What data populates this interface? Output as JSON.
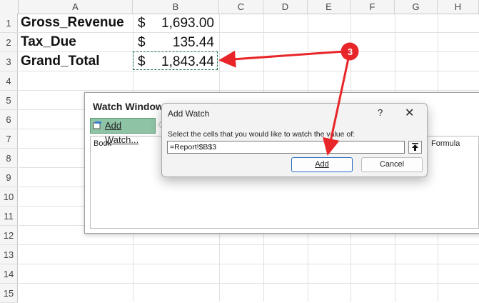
{
  "sheet": {
    "columns": [
      "A",
      "B",
      "C",
      "D",
      "E",
      "F",
      "G",
      "H"
    ],
    "rows": [
      "1",
      "2",
      "3",
      "4",
      "5",
      "6",
      "7",
      "8",
      "9",
      "10",
      "11",
      "12",
      "13",
      "14",
      "15"
    ],
    "cells": [
      {
        "label": "Gross_Revenue",
        "currency": "$",
        "value": "1,693.00"
      },
      {
        "label": "Tax_Due",
        "currency": "$",
        "value": "135.44"
      },
      {
        "label": "Grand_Total",
        "currency": "$",
        "value": "1,843.44"
      }
    ]
  },
  "watch_window": {
    "title": "Watch Window",
    "add_watch_label": "Add Watch...",
    "columns": {
      "book": "Book",
      "formula": "Formula"
    }
  },
  "dialog": {
    "title": "Add Watch",
    "help": "?",
    "close": "✕",
    "prompt": "Select the cells that you would like to watch the value of:",
    "reference": "=Report!$B$3",
    "collapse_icon": "🠉",
    "add_label": "Add",
    "cancel_label": "Cancel"
  },
  "callout": {
    "step_number": "3",
    "color": "#e8262a"
  }
}
